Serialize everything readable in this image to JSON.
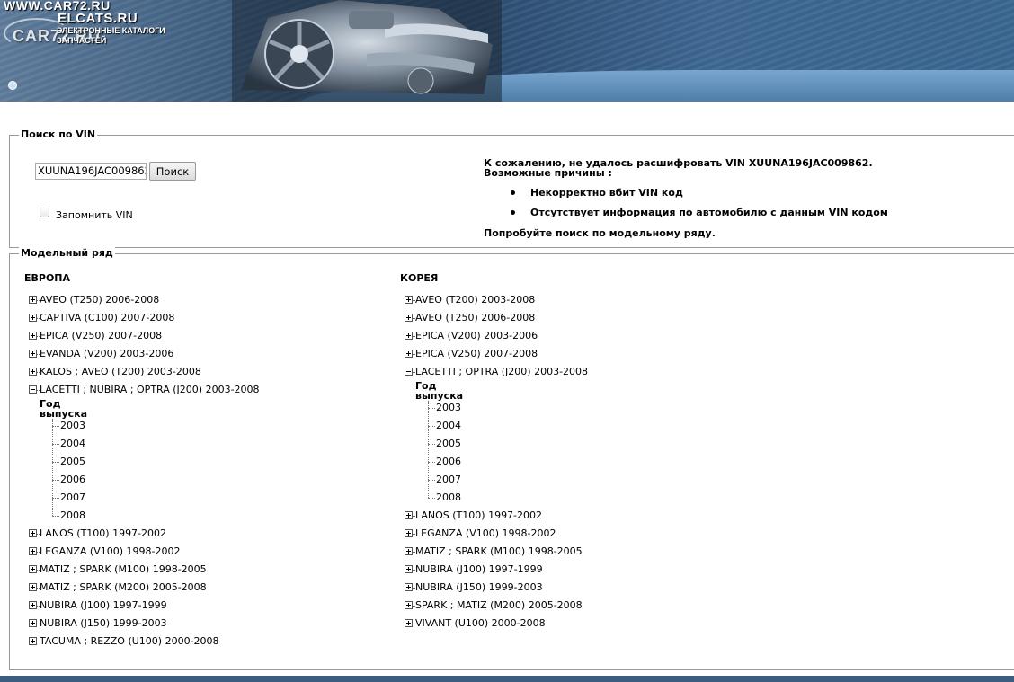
{
  "header": {
    "site": "WWW.CAR72.RU",
    "brand": "ELCATS.RU",
    "tagline": "ЭЛЕКТРОННЫЕ КАТАЛОГИ ЗАПЧАСТЕЙ",
    "watermark": "CAR72.RU",
    "colors": {
      "banner": "#3f5f81",
      "banner_light": "#78a6cf"
    }
  },
  "vin_search": {
    "legend": "Поиск по VIN",
    "input_value": "XUUNA196JAC009862",
    "button_label": "Поиск",
    "remember_label": "Запомнить VIN",
    "remember_checked": false,
    "error_title": "К сожалению, не удалось расшифровать VIN XUUNA196JAC009862.",
    "reasons_title": "Возможные причины :",
    "reasons": [
      "Некорректно вбит VIN код",
      "Отсутствует информация по автомобилю с данным VIN кодом"
    ],
    "suggestion": "Попробуйте поиск по модельному ряду."
  },
  "models": {
    "legend": "Модельный ряд",
    "year_header_1": "Год",
    "year_header_2": "выпуска",
    "europe": {
      "title": "ЕВРОПА",
      "items": [
        "AVEO (T250) 2006-2008",
        "CAPTIVA (C100) 2007-2008",
        "EPICA (V250) 2007-2008",
        "EVANDA (V200) 2003-2006",
        "KALOS ; AVEO (T200) 2003-2008",
        "LACETTI ; NUBIRA ; OPTRA (J200) 2003-2008",
        "LANOS (T100) 1997-2002",
        "LEGANZA (V100) 1998-2002",
        "MATIZ ; SPARK (M100) 1998-2005",
        "MATIZ ; SPARK (M200) 2005-2008",
        "NUBIRA (J100) 1997-1999",
        "NUBIRA (J150) 1999-2003",
        "TACUMA ; REZZO (U100) 2000-2008"
      ],
      "expanded_index": 5,
      "years": [
        "2003",
        "2004",
        "2005",
        "2006",
        "2007",
        "2008"
      ]
    },
    "korea": {
      "title": "КОРЕЯ",
      "items": [
        "AVEO (T200) 2003-2008",
        "AVEO (T250) 2006-2008",
        "EPICA (V200) 2003-2006",
        "EPICA (V250) 2007-2008",
        "LACETTI ; OPTRA (J200) 2003-2008",
        "LANOS (T100) 1997-2002",
        "LEGANZA (V100) 1998-2002",
        "MATIZ ; SPARK (M100) 1998-2005",
        "NUBIRA (J100) 1997-1999",
        "NUBIRA (J150) 1999-2003",
        "SPARK ; MATIZ (M200) 2005-2008",
        "VIVANT (U100) 2000-2008"
      ],
      "expanded_index": 4,
      "years": [
        "2003",
        "2004",
        "2005",
        "2006",
        "2007",
        "2008"
      ]
    }
  }
}
